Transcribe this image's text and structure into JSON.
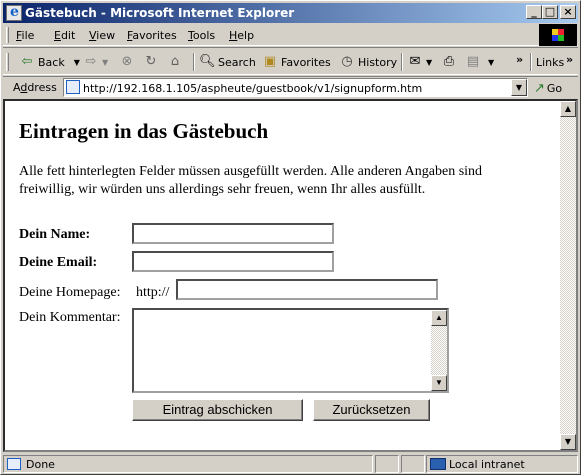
{
  "window": {
    "title": "Gästebuch - Microsoft Internet Explorer",
    "min_label": "_",
    "max_label": "□",
    "close_label": "×"
  },
  "menu": {
    "items": [
      {
        "ul": "F",
        "rest": "ile"
      },
      {
        "ul": "E",
        "rest": "dit"
      },
      {
        "ul": "V",
        "rest": "iew"
      },
      {
        "ul": "F",
        "rest": "avorites"
      },
      {
        "ul": "T",
        "rest": "ools"
      },
      {
        "ul": "H",
        "rest": "elp"
      }
    ]
  },
  "toolbar": {
    "back_label": "Back",
    "search_label": "Search",
    "favorites_label": "Favorites",
    "history_label": "History",
    "links_label": "Links",
    "chevron": "»"
  },
  "address": {
    "label_ul": "d",
    "label_pre": "A",
    "label_post": "dress",
    "url": "http://192.168.1.105/aspheute/guestbook/v1/signupform.htm",
    "go_label": "Go"
  },
  "page": {
    "heading": "Eintragen in das Gästebuch",
    "intro": "Alle fett hinterlegten Felder müssen ausgefüllt werden. Alle anderen Angaben sind freiwillig, wir würden uns allerdings sehr freuen, wenn Ihr alles ausfüllt.",
    "name_label": "Dein Name:",
    "name_value": "",
    "email_label": "Deine Email:",
    "email_value": "",
    "homepage_label": "Deine Homepage:",
    "homepage_prefix": "http://",
    "homepage_value": "",
    "comment_label": "Dein Kommentar:",
    "comment_value": "",
    "submit_label": "Eintrag abschicken",
    "reset_label": "Zurücksetzen"
  },
  "status": {
    "text": "Done",
    "zone": "Local intranet"
  }
}
